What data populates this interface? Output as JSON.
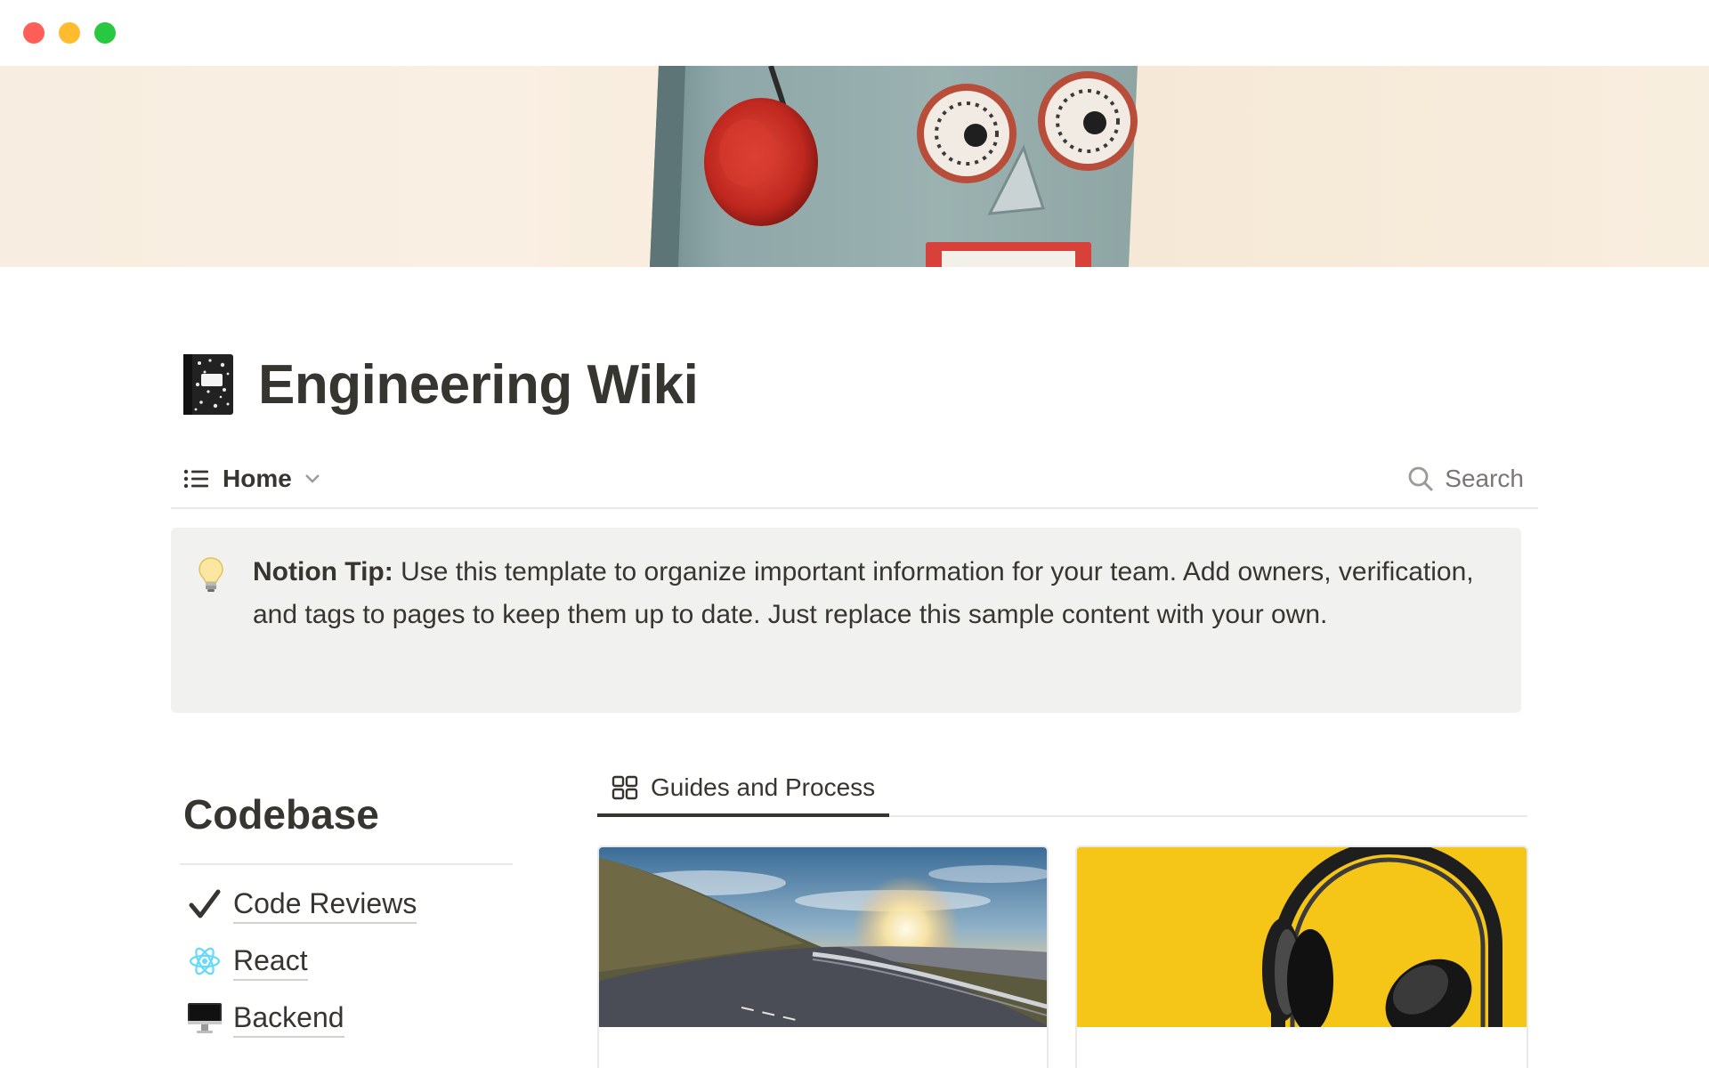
{
  "page": {
    "title": "Engineering Wiki",
    "icon": "composition-notebook-icon"
  },
  "view": {
    "current_view": "Home",
    "search_label": "Search"
  },
  "callout": {
    "icon": "lightbulb-icon",
    "bold_prefix": "Notion Tip:",
    "text": " Use this template to organize important information for your team. Add owners, verification, and tags to pages to keep them up to date. Just replace this sample content with your own."
  },
  "codebase": {
    "heading": "Codebase",
    "items": [
      {
        "label": "Code Reviews",
        "icon": "checkmark-icon"
      },
      {
        "label": "React",
        "icon": "react-atom-icon"
      },
      {
        "label": "Backend",
        "icon": "desktop-computer-icon"
      }
    ]
  },
  "gallery": {
    "tab_label": "Guides and Process",
    "tab_icon": "gallery-grid-icon",
    "cards": [
      {
        "cover": "road-sunset-image"
      },
      {
        "cover": "headphones-yellow-image"
      }
    ]
  },
  "colors": {
    "text": "#37352f",
    "muted": "#787774",
    "callout_bg": "#f1f1ef",
    "divider": "#e9e9e7",
    "react_blue": "#61dafb",
    "headphones_bg": "#f5c518"
  }
}
